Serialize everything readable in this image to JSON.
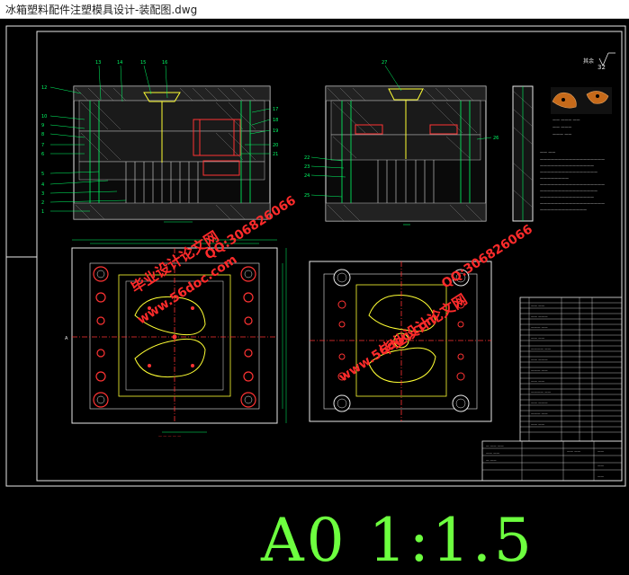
{
  "window": {
    "title": "冰箱塑料配件注塑模具设计-装配图.dwg"
  },
  "drawing": {
    "scale_label": "A0 1:1.5",
    "roughness_symbol": "32",
    "colors": {
      "background": "#000000",
      "frame": "#ffffff",
      "cad_green": "#00ff66",
      "cad_red": "#ff3333",
      "cad_yellow": "#ffff33",
      "scale_text": "#6dff3f",
      "watermark": "#ff2b2b"
    }
  },
  "watermarks": {
    "site": "www.56doc.com",
    "qq": "QQ:306826066",
    "brand": "毕业设计论文网"
  }
}
